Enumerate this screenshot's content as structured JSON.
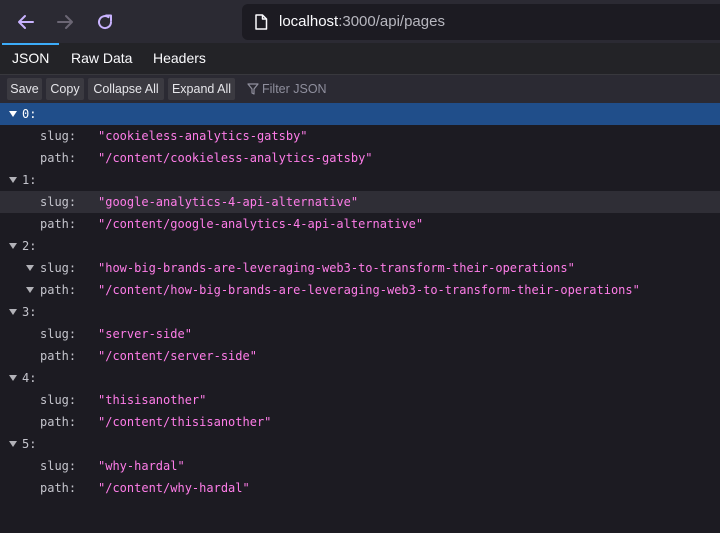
{
  "browser": {
    "url_host": "localhost",
    "url_path": ":3000/api/pages"
  },
  "tabs": [
    "JSON",
    "Raw Data",
    "Headers"
  ],
  "toolbar": {
    "save": "Save",
    "copy": "Copy",
    "collapse_all": "Collapse All",
    "expand_all": "Expand All",
    "filter_placeholder": "Filter JSON"
  },
  "json": {
    "items": [
      {
        "index": "0:",
        "slug_key": "slug:",
        "slug": "\"cookieless-analytics-gatsby\"",
        "path_key": "path:",
        "path": "\"/content/cookieless-analytics-gatsby\""
      },
      {
        "index": "1:",
        "slug_key": "slug:",
        "slug": "\"google-analytics-4-api-alternative\"",
        "path_key": "path:",
        "path": "\"/content/google-analytics-4-api-alternative\""
      },
      {
        "index": "2:",
        "slug_key": "slug:",
        "slug": "\"how-big-brands-are-leveraging-web3-to-transform-their-operations\"",
        "path_key": "path:",
        "path": "\"/content/how-big-brands-are-leveraging-web3-to-transform-their-operations\""
      },
      {
        "index": "3:",
        "slug_key": "slug:",
        "slug": "\"server-side\"",
        "path_key": "path:",
        "path": "\"/content/server-side\""
      },
      {
        "index": "4:",
        "slug_key": "slug:",
        "slug": "\"thisisanother\"",
        "path_key": "path:",
        "path": "\"/content/thisisanother\""
      },
      {
        "index": "5:",
        "slug_key": "slug:",
        "slug": "\"why-hardal\"",
        "path_key": "path:",
        "path": "\"/content/why-hardal\""
      }
    ]
  }
}
